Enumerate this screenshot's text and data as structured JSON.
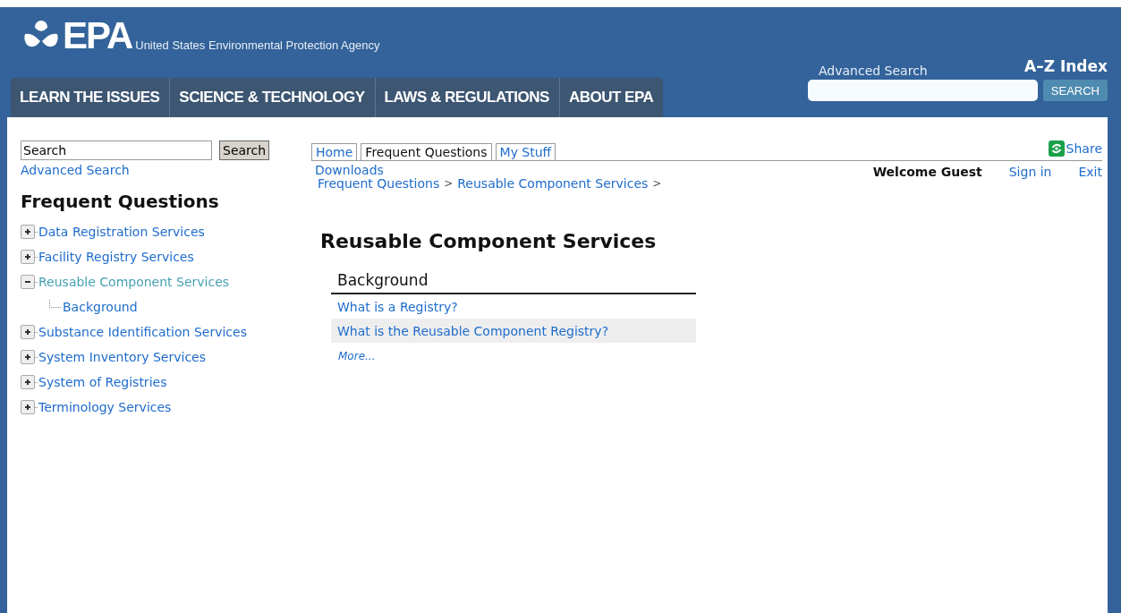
{
  "header": {
    "logo_text": "EPA",
    "agency": "United States Environmental Protection Agency",
    "nav": [
      {
        "label": "LEARN THE ISSUES"
      },
      {
        "label": "SCIENCE & TECHNOLOGY"
      },
      {
        "label": "LAWS & REGULATIONS"
      },
      {
        "label": "ABOUT EPA"
      }
    ],
    "advanced_search": "Advanced Search",
    "az_index": "A–Z Index",
    "search_button": "SEARCH"
  },
  "sidebar": {
    "search_value": "Search",
    "search_button": "Search",
    "advanced_search": "Advanced Search",
    "title": "Frequent Questions",
    "tree": [
      {
        "label": "Data Registration Services",
        "expanded": false,
        "selected": false
      },
      {
        "label": "Facility Registry Services",
        "expanded": false,
        "selected": false
      },
      {
        "label": "Reusable Component Services",
        "expanded": true,
        "selected": true,
        "children": [
          {
            "label": "Background",
            "selected": false
          }
        ]
      },
      {
        "label": "Substance Identification Services",
        "expanded": false,
        "selected": false
      },
      {
        "label": "System Inventory Services",
        "expanded": false,
        "selected": false
      },
      {
        "label": "System of Registries",
        "expanded": false,
        "selected": false
      },
      {
        "label": "Terminology Services",
        "expanded": false,
        "selected": false
      }
    ]
  },
  "tabs": [
    {
      "label": "Home",
      "selected": false
    },
    {
      "label": "Frequent Questions",
      "selected": true
    },
    {
      "label": "My Stuff",
      "selected": false
    }
  ],
  "share": "Share",
  "downloads": "Downloads",
  "welcome": "Welcome Guest",
  "sign_in": "Sign in",
  "exit": "Exit",
  "breadcrumb": [
    {
      "label": "Frequent Questions"
    },
    {
      "label": "Reusable Component Services"
    }
  ],
  "breadcrumb_separator": ">",
  "page_title": "Reusable Component Services",
  "section": {
    "title": "Background",
    "questions": [
      {
        "label": "What is a Registry?",
        "highlighted": false
      },
      {
        "label": "What is the Reusable Component Registry?",
        "highlighted": true
      }
    ],
    "more": "More..."
  }
}
